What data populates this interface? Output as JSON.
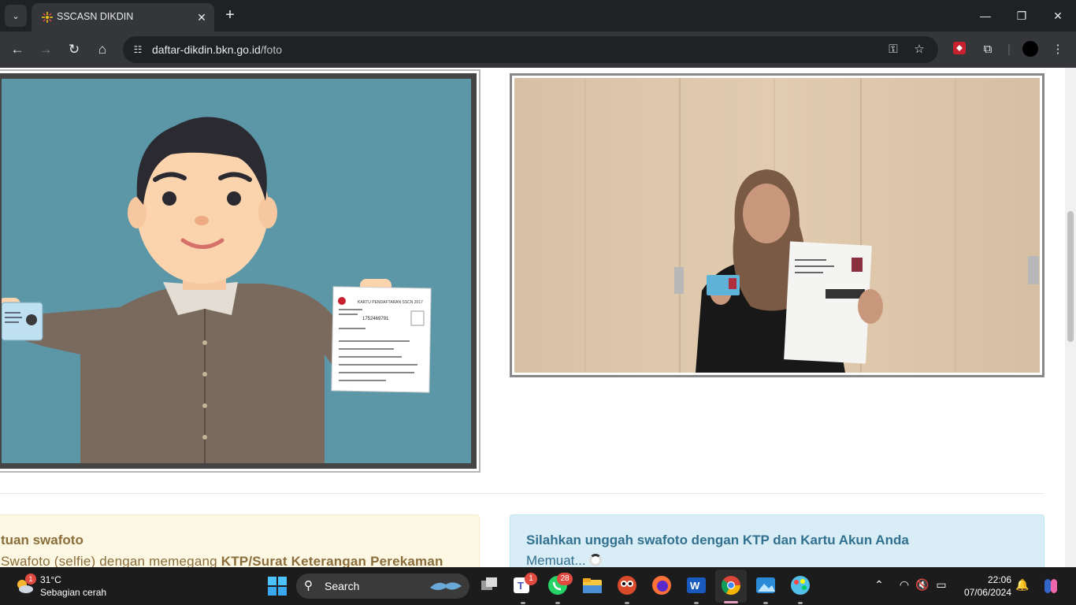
{
  "browser": {
    "tab": {
      "title": "SSCASN DIKDIN"
    },
    "url": {
      "host": "daftar-dikdin.bkn.go.id",
      "path": "/foto"
    },
    "colors": {
      "chrome_dark": "#202124",
      "chrome_toolbar": "#35363a"
    }
  },
  "page": {
    "left_alert": {
      "title": "tuan swafoto",
      "body_plain": "Swafoto (selfie) dengan memegang ",
      "body_bold": "KTP/Surat Keterangan Perekaman"
    },
    "right_alert": {
      "title": "Silahkan unggah swafoto dengan KTP dan Kartu Akun Anda",
      "loading": "Memuat..."
    },
    "illustration_card": {
      "header": "KARTU PENDAFTARAN SSCN 2017",
      "number": "1752469791"
    },
    "colors": {
      "warning_bg": "#fcf8e3",
      "warning_text": "#8a6d3b",
      "info_bg": "#d9edf7",
      "info_text": "#31708f"
    }
  },
  "taskbar": {
    "weather": {
      "temp": "31°C",
      "desc": "Sebagian cerah",
      "badge": "1"
    },
    "search_label": "Search",
    "badges": {
      "teams": "1",
      "whatsapp": "28"
    },
    "clock": {
      "time": "22:06",
      "date": "07/06/2024"
    }
  }
}
